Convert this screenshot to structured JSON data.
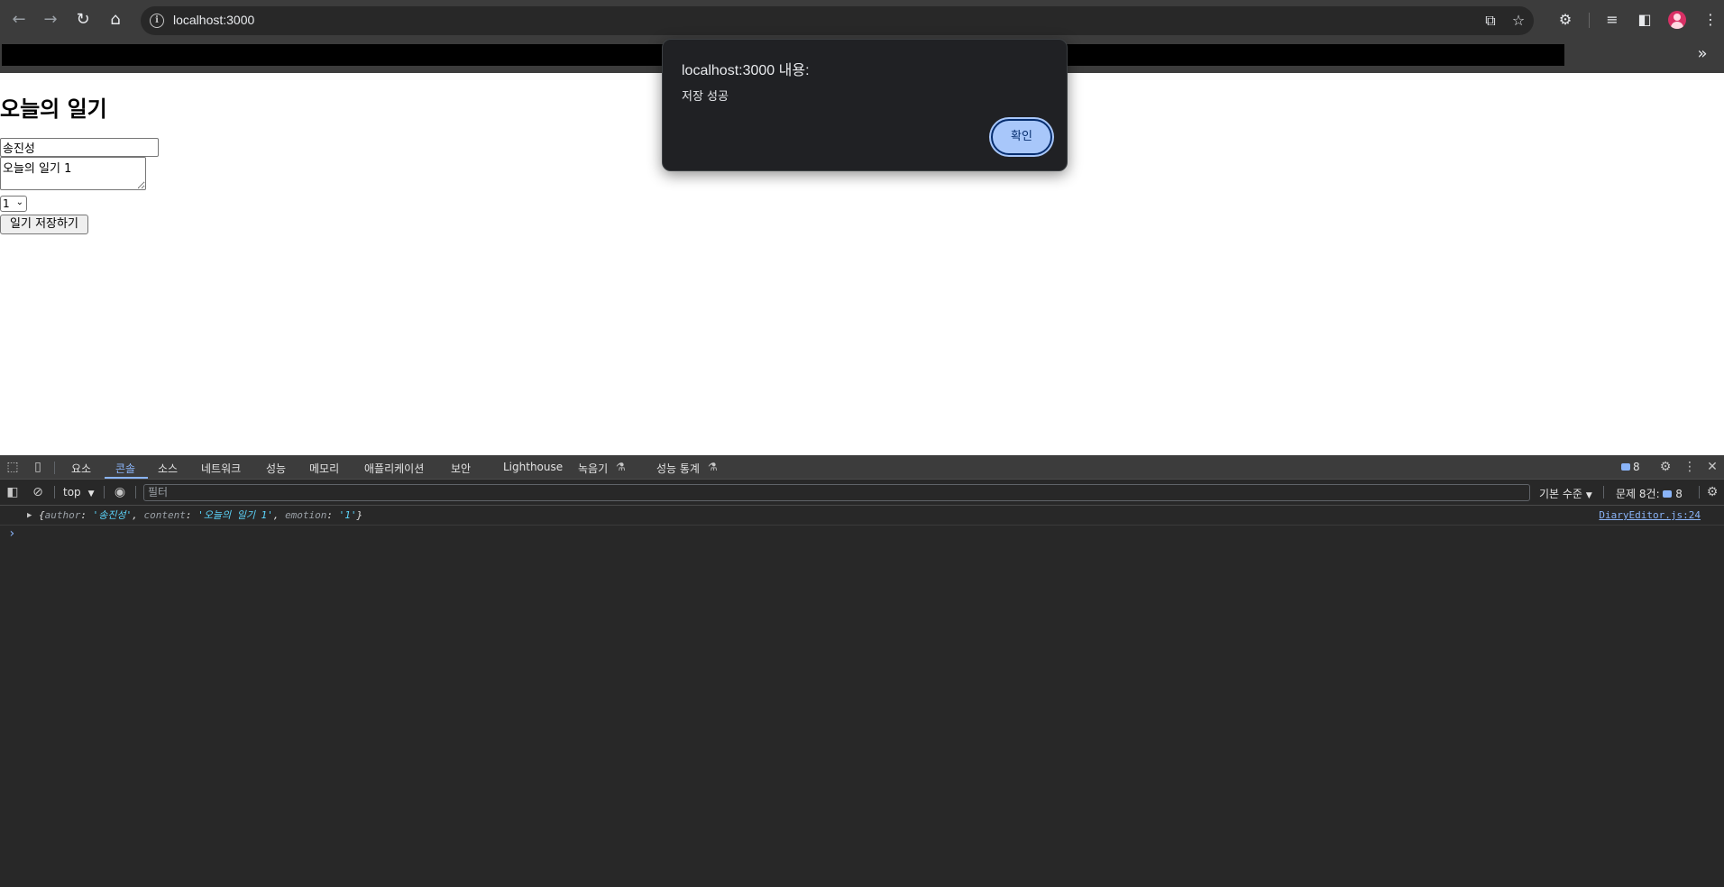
{
  "browser": {
    "url": "localhost:3000",
    "icons": [
      "back-arrow-icon",
      "forward-arrow-icon",
      "reload-icon",
      "home-icon",
      "info-icon",
      "install-app-icon",
      "star-icon",
      "extensions-icon",
      "reading-list-icon",
      "side-panel-icon",
      "profile-avatar",
      "kebab-menu-icon"
    ],
    "bookmarks_more": "»"
  },
  "page": {
    "heading": "오늘의 일기",
    "author_value": "송진성",
    "content_value": "오늘의 일기 1",
    "emotion_value": "1",
    "save_button": "일기 저장하기"
  },
  "dialog": {
    "title": "localhost:3000 내용:",
    "message": "저장 성공",
    "ok_button": "확인",
    "ok_color": "#a8c7fa"
  },
  "devtools": {
    "tabs": [
      {
        "label": "요소",
        "active": false
      },
      {
        "label": "콘솔",
        "active": true
      },
      {
        "label": "소스",
        "active": false
      },
      {
        "label": "네트워크",
        "active": false
      },
      {
        "label": "성능",
        "active": false
      },
      {
        "label": "메모리",
        "active": false
      },
      {
        "label": "애플리케이션",
        "active": false
      },
      {
        "label": "보안",
        "active": false
      },
      {
        "label": "Lighthouse",
        "active": false
      },
      {
        "label": "녹음기",
        "active": false
      },
      {
        "label": "성능 통계",
        "active": false
      }
    ],
    "message_count": "8",
    "context": "top",
    "filter_placeholder": "필터",
    "level": "기본 수준",
    "issues_label": "문제 8건:",
    "issues_count": "8",
    "log": {
      "open": "{",
      "author_key": "author",
      "author_val": "'송진성'",
      "content_key": "content",
      "content_val": "'오늘의 일기 1'",
      "emotion_key": "emotion",
      "emotion_val": "'1'",
      "close": "}",
      "source": "DiaryEditor.js:24"
    },
    "prompt": "›"
  }
}
